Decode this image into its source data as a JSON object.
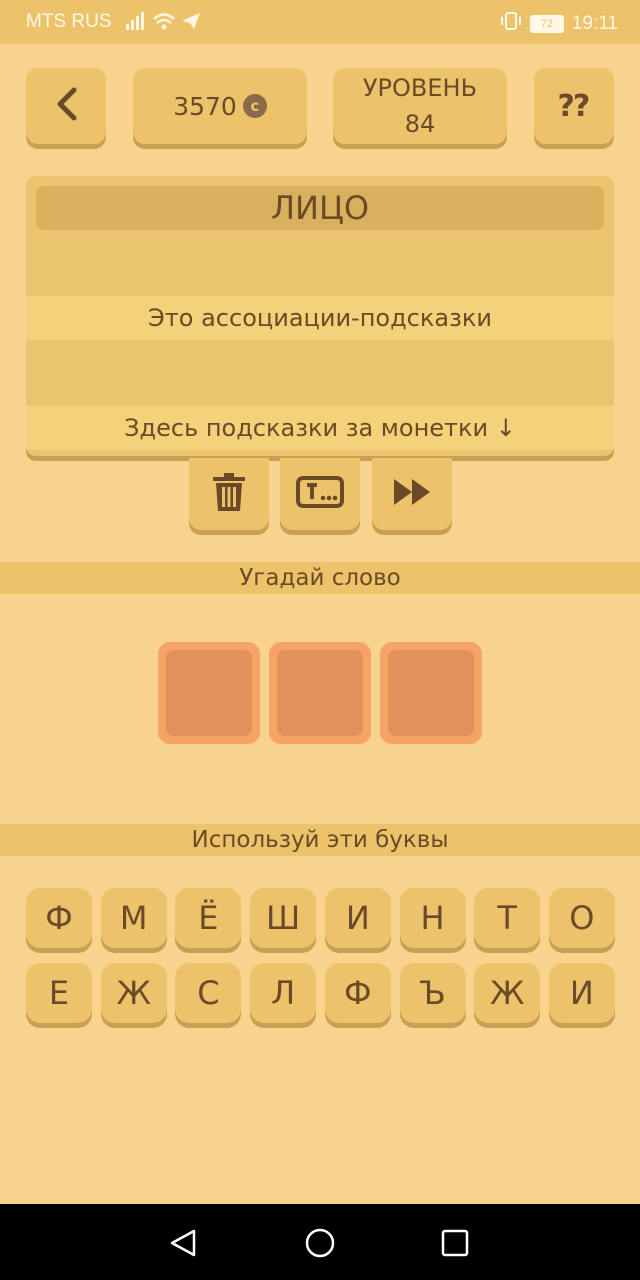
{
  "status": {
    "carrier": "MTS RUS",
    "battery": "72",
    "time": "19:11"
  },
  "header": {
    "coins": "3570",
    "coin_symbol": "c",
    "level_label": "УРОВЕНЬ",
    "level_number": "84",
    "help_glyph": "⁇"
  },
  "panel": {
    "word": "ЛИЦО",
    "hint1": "Это ассоциации-подсказки",
    "hint2": "Здесь подсказки за монетки ↓"
  },
  "sections": {
    "guess": "Угадай слово",
    "letters": "Используй эти буквы"
  },
  "answer_slots": 3,
  "letters": {
    "row1": [
      "Ф",
      "М",
      "Ё",
      "Ш",
      "И",
      "Н",
      "Т",
      "О"
    ],
    "row2": [
      "Е",
      "Ж",
      "С",
      "Л",
      "Ф",
      "Ъ",
      "Ж",
      "И"
    ]
  },
  "icons": {
    "back": "chevron-left-icon",
    "delete": "trash-icon",
    "reveal": "text-box-icon",
    "skip": "fast-forward-icon"
  },
  "colors": {
    "background": "#f7d38d",
    "button": "#ecc26b",
    "slot": "#f5a466",
    "text": "#6b4a27"
  }
}
